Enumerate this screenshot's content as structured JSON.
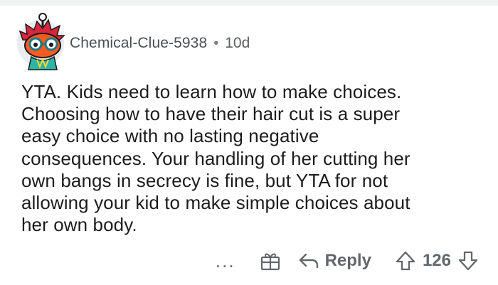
{
  "comment": {
    "username": "Chemical-Clue-5938",
    "separator": "•",
    "age": "10d",
    "lines": [
      "YTA. Kids need to learn how to make choices.",
      "Choosing how to have their hair cut is a super",
      "easy choice with no lasting negative",
      "consequences. Your handling of her cutting her",
      "own bangs in secrecy is fine, but YTA for not",
      "allowing your kid to make simple choices about",
      "her own body."
    ]
  },
  "actions": {
    "more_label": "...",
    "reply_label": "Reply",
    "vote_count": "126"
  },
  "icons": {
    "avatar": "reddit-snoo-avatar-icon",
    "more": "more-options-icon",
    "gift": "award-gift-icon",
    "reply": "reply-arrow-icon",
    "upvote": "upvote-arrow-icon",
    "downvote": "downvote-arrow-icon"
  },
  "colors": {
    "text": "#1c1c1c",
    "meta": "#5a5f63",
    "icon": "#61676b",
    "avatar_hair": "#d7263d",
    "avatar_face": "#ff4500"
  }
}
